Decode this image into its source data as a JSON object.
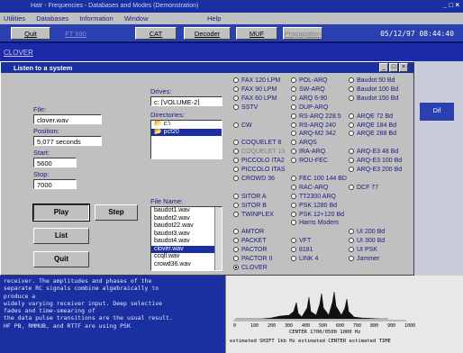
{
  "app": {
    "title": "Hatr - Frequencies - Databases and Modes (Demonstration)",
    "clock": "05/12/97 08:44:40",
    "menu": [
      "Utilities",
      "Databases",
      "Information",
      "Window",
      "Help"
    ],
    "toolbar": [
      "Quit",
      "FT 990",
      "CAT",
      "Decoder",
      "MUF",
      "Propagation"
    ],
    "mode_label": "CLOVER"
  },
  "dialog": {
    "title": "Listen to a system",
    "file_label": "File:",
    "file_value": "clover.wav",
    "position_label": "Position:",
    "position_value": "5,077 seconds",
    "start_label": "Start:",
    "start_value": "5600",
    "stop_label": "Stop:",
    "stop_value": "7000",
    "play": "Play",
    "step": "Step",
    "list": "List",
    "quit": "Quit",
    "drives_label": "Drives:",
    "drive_value": "c: [VOLUME-2]",
    "directories_label": "Directories:",
    "directories": [
      "c:\\",
      "pcf20"
    ],
    "filename_label": "File Name:",
    "files": [
      "baudot1.wav",
      "baudot2.wav",
      "baudot22.wav",
      "baudot3.wav",
      "baudot4.wav",
      "clover.wav",
      "ccqll.wav",
      "crowd36.wav"
    ],
    "selected_file": "clover.wav",
    "modes_col1": [
      "FAX 120 LPM",
      "FAX  90 LPM",
      "FAX  60 LPM",
      "SSTV",
      "",
      "CW",
      "",
      "COQUELET 8",
      "COQUELET 13",
      "PICCOLO ITA2",
      "PICCOLO ITAS",
      "CROWD 36",
      "",
      "SITOR A",
      "SITOR B",
      "TWINPLEX",
      "",
      "AMTOR",
      "PACKET",
      "PACTOR",
      "PACTOR II",
      "CLOVER"
    ],
    "modes_col2": [
      "POL-ARQ",
      "SW-ARQ",
      "ARQ 6-90",
      "DUP-ARQ",
      "RS-ARQ 228.5",
      "RS-ARQ 240",
      "ARQ-M2 342",
      "ARQS",
      "IRA-ARQ",
      "ROU-FEC",
      "",
      "FEC 100 144 BD",
      "RAC-ARQ",
      "TT2300 ARQ",
      "PSK 1280 Bd",
      "PSK 12+120 Bd",
      "Harris Modem",
      "",
      "VFT",
      "8181",
      "LINK 4"
    ],
    "modes_col3": [
      "Baudot 50 Bd",
      "Baudot 100 Bd",
      "Baudot 150 Bd",
      "",
      "ARQE 72 Bd",
      "ARQE 184 Bd",
      "ARQE 288 Bd",
      "",
      "ARQ-E3 48 Bd",
      "ARQ-E3 100 Bd",
      "ARQ-E3 200 Bd",
      "",
      "DCF 77",
      "",
      "",
      "",
      "",
      "UI 200 Bd",
      "UI 300 Bd",
      "UI PSK",
      "Jammer"
    ],
    "selected_mode": "CLOVER"
  },
  "side": {
    "button": "Dif"
  },
  "description": {
    "lines": [
      "receiver. The amplitudes and phases of the",
      "separate RC signals combine algebraically to",
      "produce a",
      "widely varying receiver input. Deep selective",
      "fades and time-smearing of",
      "the data pulse transitions are the usual result.",
      "",
      "HF PB, RMMUB, and RTTF are using PSK"
    ]
  },
  "spectrum": {
    "axis_labels": [
      "0",
      "100",
      "200",
      "300",
      "400",
      "500",
      "600",
      "700",
      "800",
      "900",
      "1000"
    ],
    "status": "CENTER 1700/0500 1000 Hz",
    "footer": "estimated SHIFT  1kb Hz  estimated CENTER  estimated  TIME"
  }
}
